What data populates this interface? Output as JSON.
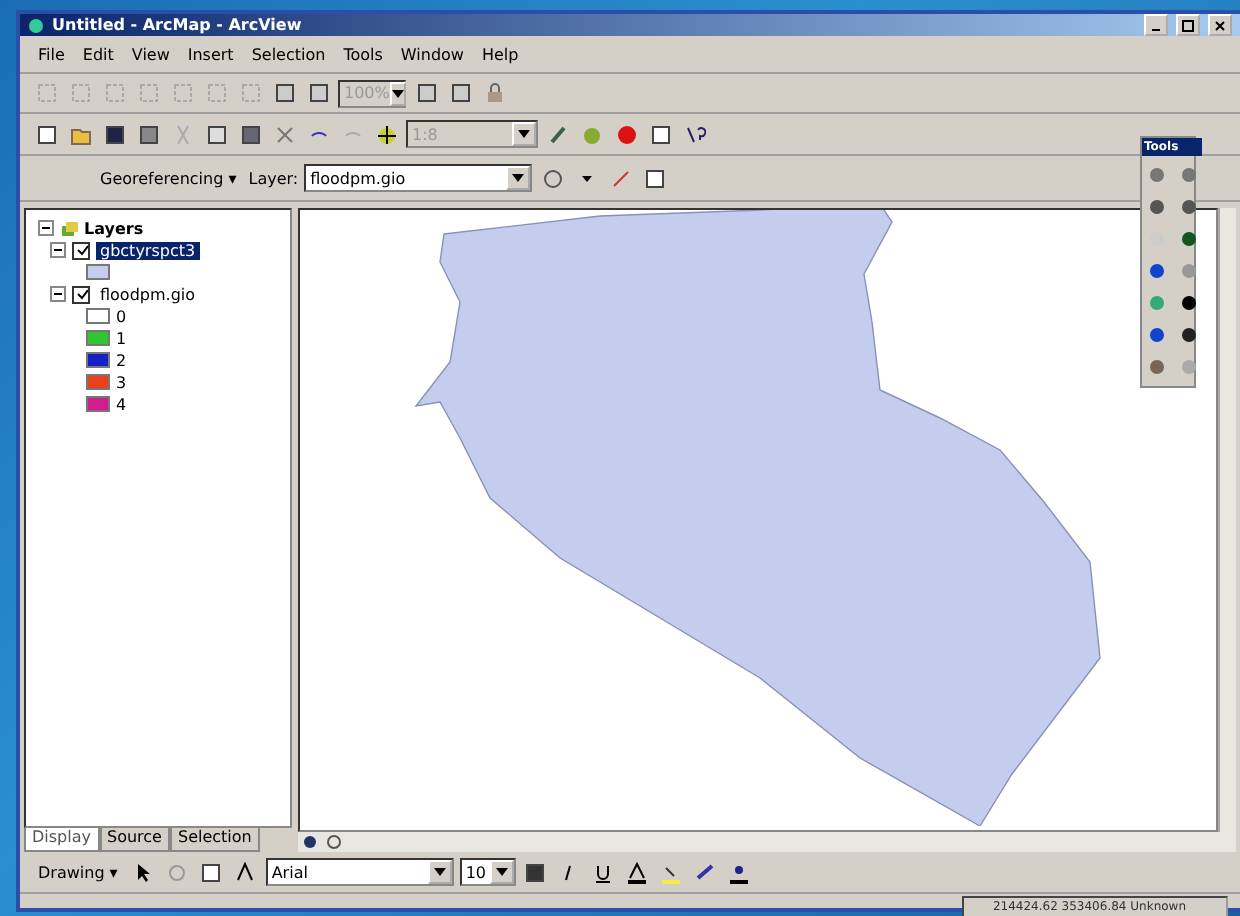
{
  "window": {
    "title": "Untitled - ArcMap - ArcView"
  },
  "menu": [
    "File",
    "Edit",
    "View",
    "Insert",
    "Selection",
    "Tools",
    "Window",
    "Help"
  ],
  "toolbar_1": {
    "zoom_combo": {
      "value": "100%",
      "disabled": true
    }
  },
  "toolbar_2": {
    "scale_combo": {
      "value": "1:8",
      "disabled": true
    }
  },
  "georeferencing": {
    "menu": "Georeferencing ▾",
    "layer_label": "Layer:",
    "layer_value": "floodpm.gio"
  },
  "toc": {
    "root": "Layers",
    "layers": [
      {
        "name": "gbctyrspct3",
        "checked": true,
        "selected": true,
        "expanded": true,
        "classes": [
          {
            "color": "#c5cdee"
          }
        ]
      },
      {
        "name": "floodpm.gio",
        "checked": true,
        "selected": false,
        "expanded": true,
        "classes": [
          {
            "label": "0",
            "color": "#ffffff"
          },
          {
            "label": "1",
            "color": "#2fc62f"
          },
          {
            "label": "2",
            "color": "#1420c8"
          },
          {
            "label": "3",
            "color": "#e8401c"
          },
          {
            "label": "4",
            "color": "#d01c8c"
          }
        ]
      }
    ]
  },
  "toc_tabs": [
    {
      "label": "Display",
      "selected": true
    },
    {
      "label": "Source",
      "selected": false
    },
    {
      "label": "Selection",
      "selected": false
    }
  ],
  "tools_window": {
    "title": "Tools"
  },
  "drawing_toolbar": {
    "menu": "Drawing ▾",
    "font": "Arial",
    "size": "10"
  },
  "status_bar": {
    "coordinates": "214424.62  353406.84 Unknown"
  }
}
